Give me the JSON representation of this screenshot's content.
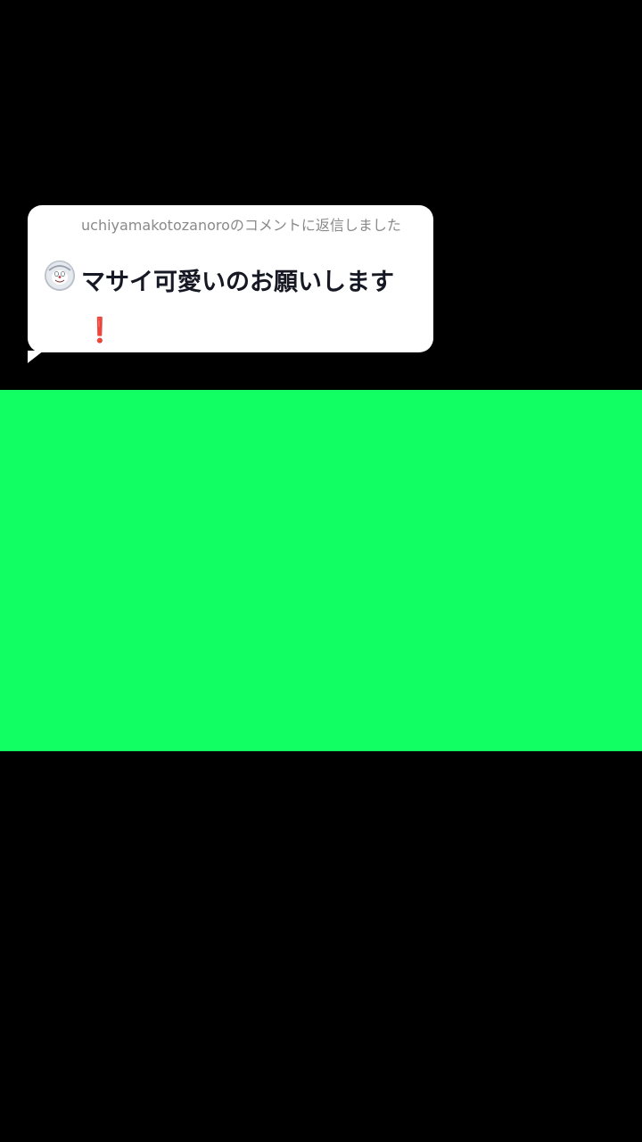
{
  "reply_sticker": {
    "header": "uchiyamakotozanoroのコメントに返信しました",
    "message": "マサイ可愛いのお願いします",
    "emoji": "❗",
    "avatar_icon": "user-avatar"
  },
  "video": {
    "background_color": "#000000",
    "green_screen_color": "#12ff64"
  }
}
